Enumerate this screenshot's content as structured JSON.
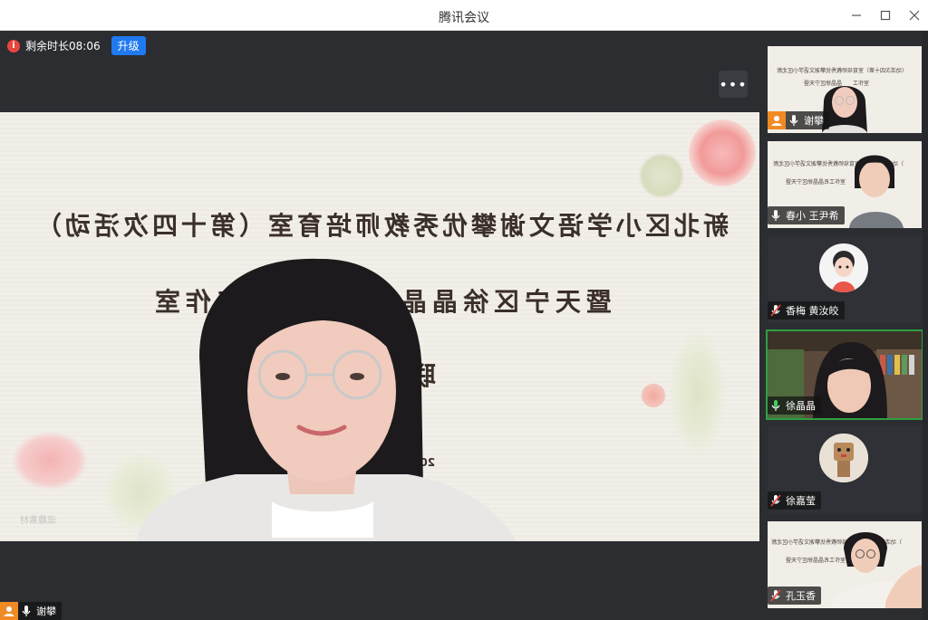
{
  "window": {
    "title": "腾讯会议",
    "controls": [
      "minimize",
      "maximize",
      "close"
    ]
  },
  "meeting": {
    "remaining_label": "剩余时长08:06",
    "upgrade_label": "升级",
    "more_label": "•••"
  },
  "slide": {
    "line1": "新北区小学语文谢攀优秀教师培育室（第十四次活动）",
    "line2": "暨天宁区徐晶晶名　　　　工作室",
    "line3": "联合教　　",
    "year_fragment": "202",
    "watermark": "逗趣素材"
  },
  "main_speaker": {
    "name": "谢攀"
  },
  "participants": [
    {
      "name": "谢攀",
      "video": "slide",
      "mic": "on",
      "host": true
    },
    {
      "name": "春小 王尹希",
      "video": "slide",
      "mic": "on",
      "host": false
    },
    {
      "name": "香梅 黄汝皎",
      "video": "avatar",
      "mic": "muted",
      "host": false
    },
    {
      "name": "徐晶晶",
      "video": "camera",
      "mic": "on",
      "host": false,
      "active": true
    },
    {
      "name": "徐嘉莹",
      "video": "avatar",
      "mic": "muted",
      "host": false
    },
    {
      "name": "孔玉香",
      "video": "slide",
      "mic": "muted",
      "host": false
    }
  ],
  "colors": {
    "accent": "#1f7af0",
    "host_badge": "#f08a24",
    "muted": "#e8453c",
    "active_speaker": "#2ea043"
  },
  "icons": [
    "info-icon",
    "more-icon",
    "user-icon",
    "mic-icon",
    "mic-muted-icon"
  ]
}
